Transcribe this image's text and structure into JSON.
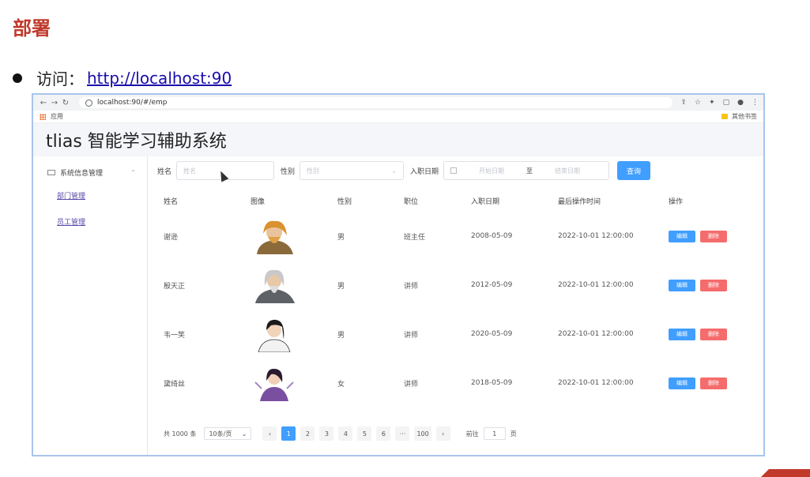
{
  "slide": {
    "title": "部署",
    "visit_label": "访问：",
    "visit_url": "http://localhost:90"
  },
  "browser": {
    "url": "localhost:90/#/emp",
    "bookmarks_apps": "应用",
    "bookmarks_other": "其他书签"
  },
  "app": {
    "title": "tlias 智能学习辅助系统"
  },
  "sidebar": {
    "group": "系统信息管理",
    "items": [
      {
        "label": "部门管理"
      },
      {
        "label": "员工管理"
      }
    ]
  },
  "search": {
    "name_label": "姓名",
    "name_placeholder": "姓名",
    "gender_label": "性别",
    "gender_placeholder": "性别",
    "date_label": "入职日期",
    "start_placeholder": "开始日期",
    "range_sep": "至",
    "end_placeholder": "结束日期",
    "query_button": "查询"
  },
  "table": {
    "headers": [
      "姓名",
      "图像",
      "性别",
      "职位",
      "入职日期",
      "最后操作时间",
      "操作"
    ],
    "edit_label": "编辑",
    "delete_label": "删除",
    "rows": [
      {
        "name": "谢逊",
        "gender": "男",
        "position": "班主任",
        "entry_date": "2008-05-09",
        "update_time": "2022-10-01 12:00:00"
      },
      {
        "name": "殷天正",
        "gender": "男",
        "position": "讲师",
        "entry_date": "2012-05-09",
        "update_time": "2022-10-01 12:00:00"
      },
      {
        "name": "韦一笑",
        "gender": "男",
        "position": "讲师",
        "entry_date": "2020-05-09",
        "update_time": "2022-10-01 12:00:00"
      },
      {
        "name": "黛绮丝",
        "gender": "女",
        "position": "讲师",
        "entry_date": "2018-05-09",
        "update_time": "2022-10-01 12:00:00"
      }
    ]
  },
  "pagination": {
    "total": "共 1000 条",
    "page_size": "10条/页",
    "pages": [
      "1",
      "2",
      "3",
      "4",
      "5",
      "6",
      "···",
      "100"
    ],
    "goto_label": "前往",
    "goto_value": "1",
    "page_unit": "页"
  },
  "colors": {
    "primary": "#409eff",
    "danger": "#f56c6c",
    "slide_title": "#c0392b"
  }
}
